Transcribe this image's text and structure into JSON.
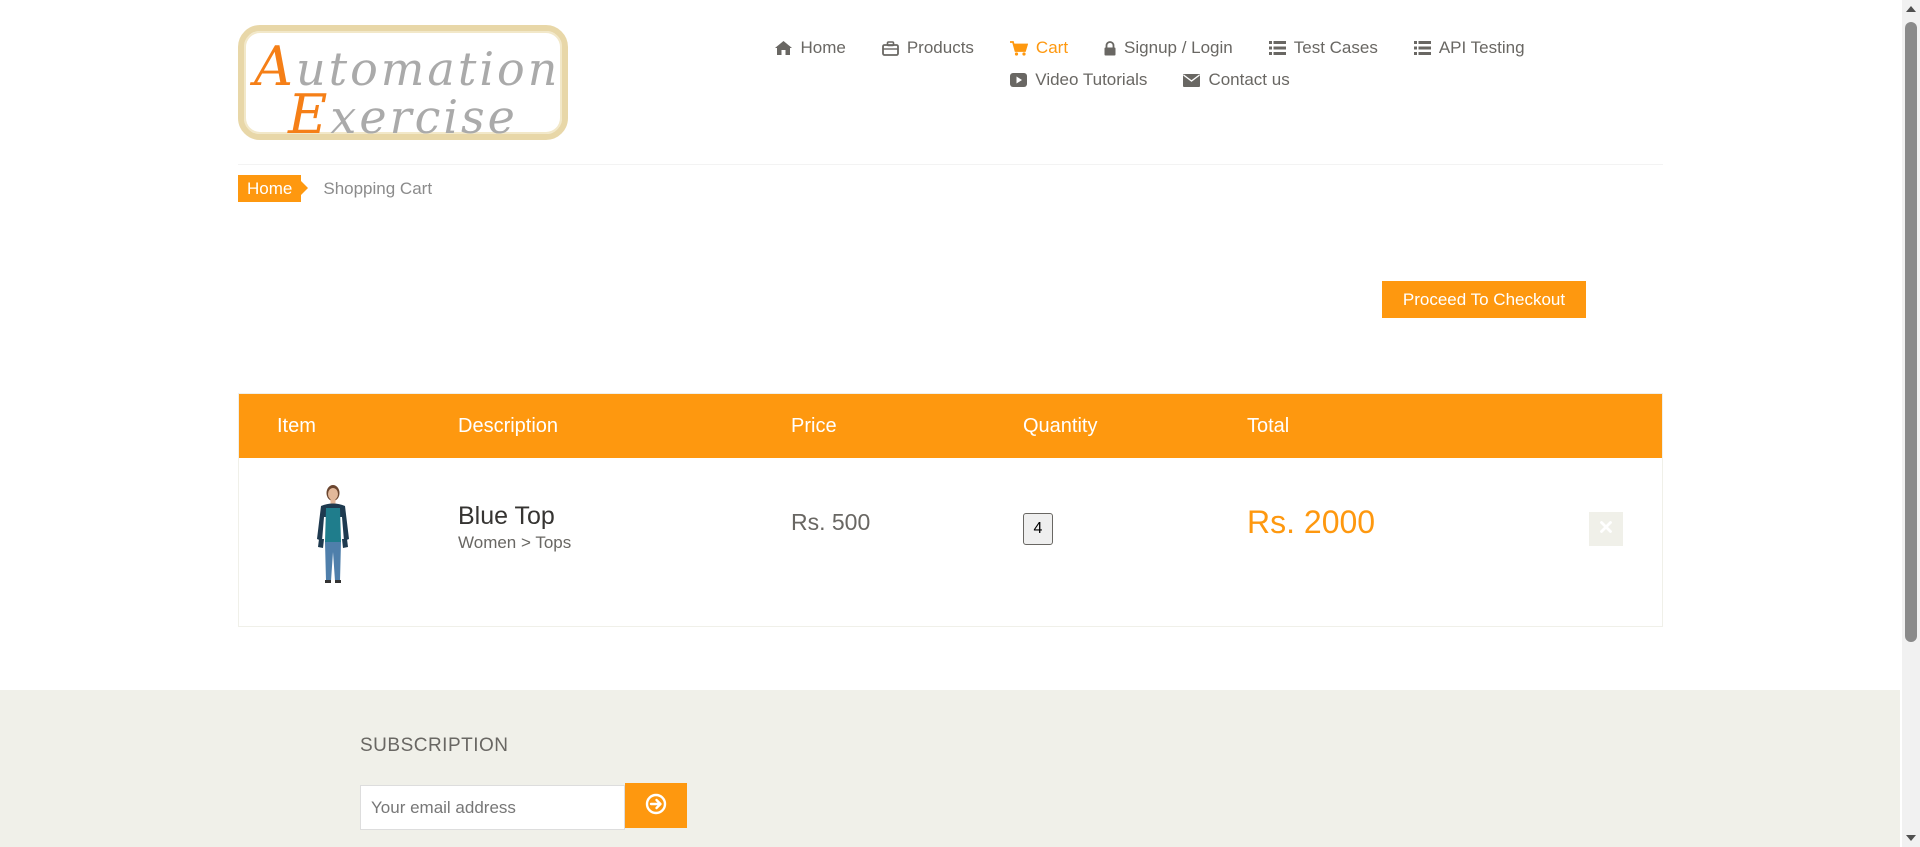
{
  "logo": {
    "line1_cap": "A",
    "line1_rest": "utomation",
    "line2_cap": "E",
    "line2_rest": "xercise"
  },
  "nav": {
    "items": [
      {
        "label": "Home",
        "icon": "home-icon"
      },
      {
        "label": "Products",
        "icon": "briefcase-icon"
      },
      {
        "label": "Cart",
        "icon": "cart-icon",
        "active": true
      },
      {
        "label": "Signup / Login",
        "icon": "lock-icon"
      },
      {
        "label": "Test Cases",
        "icon": "list-icon"
      },
      {
        "label": "API Testing",
        "icon": "list-icon"
      },
      {
        "label": "Video Tutorials",
        "icon": "youtube-play-icon"
      },
      {
        "label": "Contact us",
        "icon": "envelope-icon"
      }
    ]
  },
  "breadcrumb": {
    "home": "Home",
    "current": "Shopping Cart"
  },
  "checkout": {
    "label": "Proceed To Checkout"
  },
  "cart": {
    "headers": {
      "item": "Item",
      "description": "Description",
      "price": "Price",
      "quantity": "Quantity",
      "total": "Total"
    },
    "rows": [
      {
        "name": "Blue Top",
        "category": "Women > Tops",
        "price": "Rs. 500",
        "quantity": "4",
        "total": "Rs. 2000"
      }
    ]
  },
  "subscription": {
    "title": "SUBSCRIPTION",
    "placeholder": "Your email address"
  },
  "colors": {
    "accent": "#FE980F",
    "footer_bg": "#F0F0E9",
    "text": "#696763"
  }
}
